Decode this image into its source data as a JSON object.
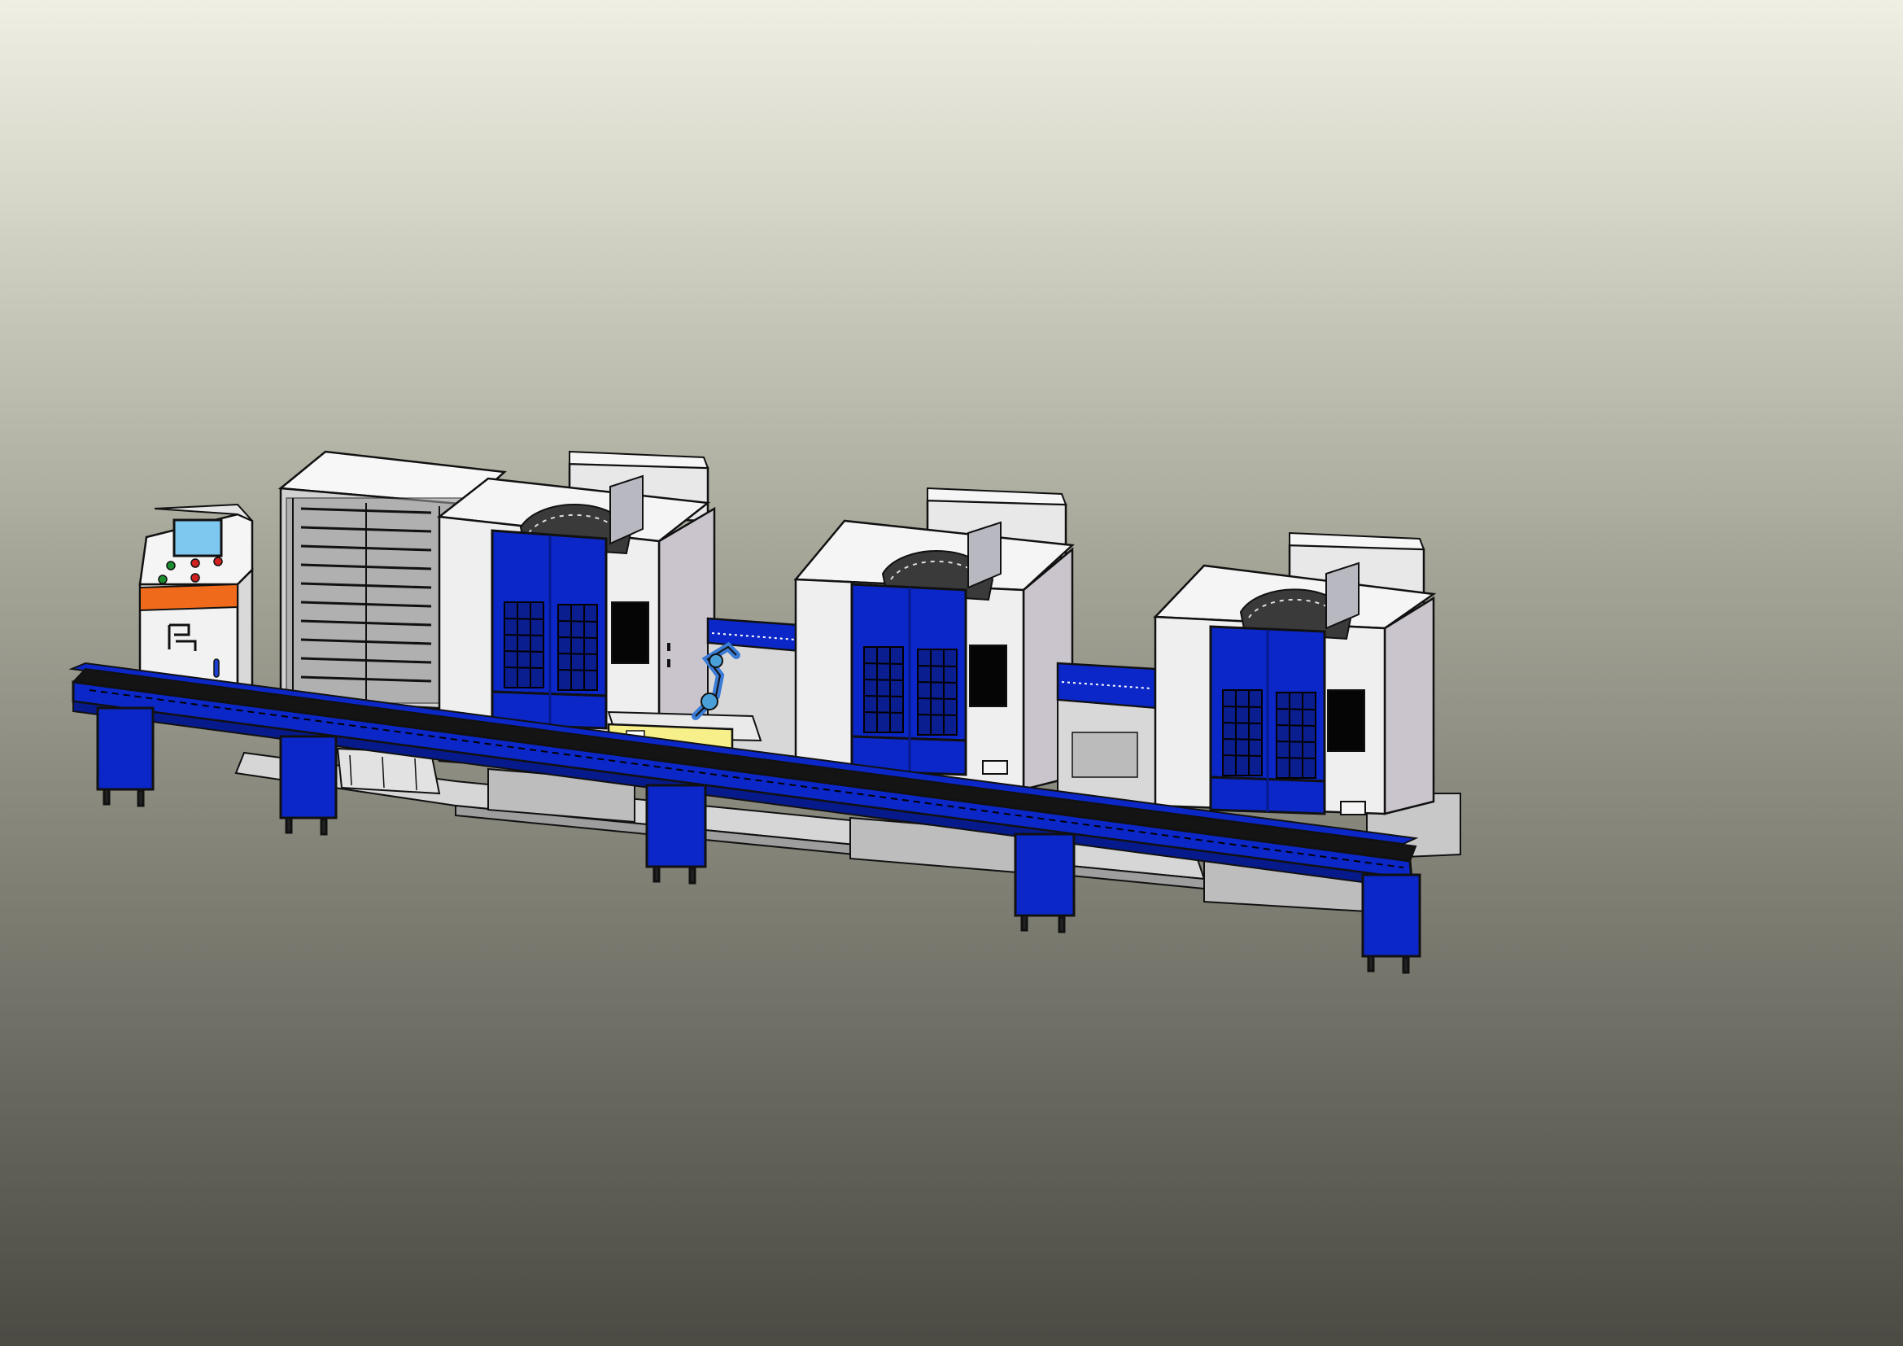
{
  "viewport": {
    "background_top": "#efefe4",
    "background_bottom": "#4b4b44"
  },
  "colors": {
    "machine_blue": "#0b27c8",
    "machine_blue_dark": "#061a8c",
    "panel_white": "#efefef",
    "panel_side": "#cac4cc",
    "rail_black": "#141414",
    "accent_orange": "#f06a1c",
    "gripper_yellow": "#f7f08a",
    "screen_cyan": "#7ec7ee"
  },
  "scene": {
    "description_hidden": "",
    "machines": [
      {
        "id": "machining-center-1"
      },
      {
        "id": "machining-center-2"
      },
      {
        "id": "machining-center-3"
      }
    ],
    "control_cabinet": {
      "logo_icon": "company-logo-icon"
    },
    "robot": {
      "icon": "robot-arm-icon"
    }
  }
}
